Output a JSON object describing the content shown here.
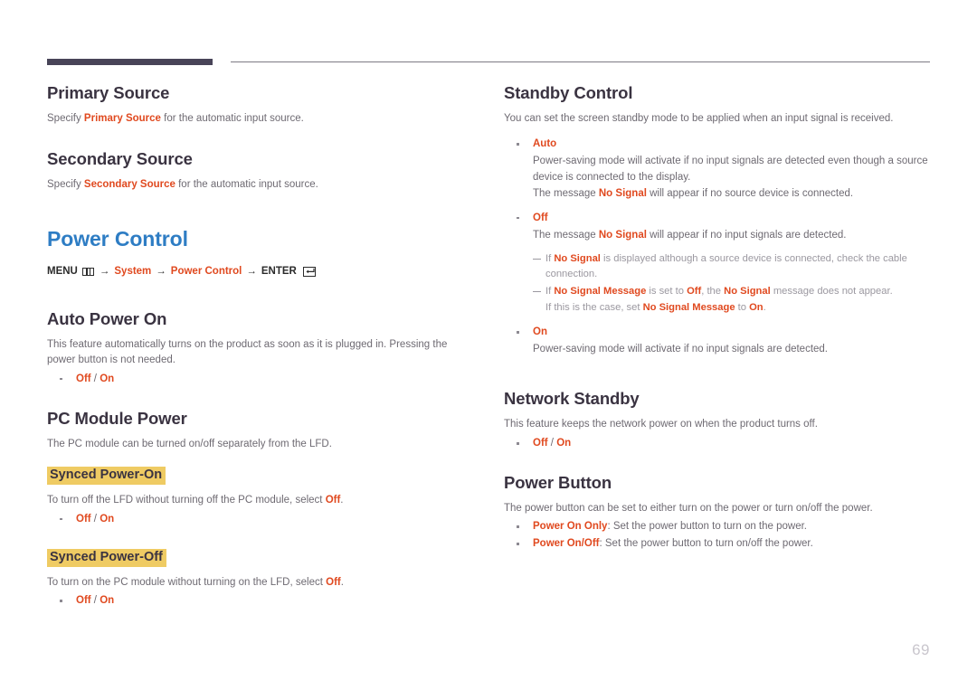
{
  "page": {
    "number": "69"
  },
  "left_column": {
    "primary_source": {
      "heading": "Primary Source",
      "desc_pre": "Specify ",
      "desc_term": "Primary Source",
      "desc_post": " for the automatic input source."
    },
    "secondary_source": {
      "heading": "Secondary Source",
      "desc_pre": "Specify ",
      "desc_term": "Secondary Source",
      "desc_post": " for the automatic input source."
    },
    "power_control": {
      "heading": "Power Control",
      "menu_label": "MENU",
      "menu_icon": "menu-grid-icon",
      "arrow": "→",
      "path_item_1": "System",
      "path_item_2": "Power Control",
      "enter_label": "ENTER",
      "enter_icon": "enter-key-icon"
    },
    "auto_power_on": {
      "heading": "Auto Power On",
      "desc": "This feature automatically turns on the product as soon as it is plugged in. Pressing the power button is not needed.",
      "options": "Off / On",
      "option_off": "Off",
      "option_sep": " / ",
      "option_on": "On"
    },
    "pc_module_power": {
      "heading": "PC Module Power",
      "desc": "The PC module can be turned on/off separately from the LFD.",
      "synced_power_on": {
        "heading": "Synced Power-On",
        "desc_pre": "To turn off the LFD without turning off the PC module, select ",
        "desc_term": "Off",
        "desc_post": ".",
        "option_off": "Off",
        "option_sep": " / ",
        "option_on": "On"
      },
      "synced_power_off": {
        "heading": "Synced Power-Off",
        "desc_pre": "To turn on the PC module without turning on the LFD, select ",
        "desc_term": "Off",
        "desc_post": ".",
        "option_off": "Off",
        "option_sep": " / ",
        "option_on": "On"
      }
    }
  },
  "right_column": {
    "standby_control": {
      "heading": "Standby Control",
      "desc": "You can set the screen standby mode to be applied when an input signal is received.",
      "auto": {
        "label": "Auto",
        "line1": "Power-saving mode will activate if no input signals are detected even though a source device is connected to the display.",
        "line2_pre": "The message ",
        "line2_term": "No Signal",
        "line2_post": " will appear if no source device is connected."
      },
      "off": {
        "label": "Off",
        "line1_pre": "The message ",
        "line1_term": "No Signal",
        "line1_post": " will appear if no input signals are detected.",
        "note1_pre": "If ",
        "note1_term": "No Signal",
        "note1_post": " is displayed although a source device is connected, check the cable connection.",
        "note2_pre": "If ",
        "note2_term1": "No Signal Message",
        "note2_mid1": " is set to ",
        "note2_term2": "Off",
        "note2_mid2": ", the ",
        "note2_term3": "No Signal",
        "note2_post": " message does not appear.",
        "note2_cont_pre": "If this is the case, set ",
        "note2_cont_term": "No Signal Message",
        "note2_cont_mid": " to ",
        "note2_cont_term2": "On",
        "note2_cont_post": "."
      },
      "on": {
        "label": "On",
        "line1": "Power-saving mode will activate if no input signals are detected."
      }
    },
    "network_standby": {
      "heading": "Network Standby",
      "desc": "This feature keeps the network power on when the product turns off.",
      "option_off": "Off",
      "option_sep": " / ",
      "option_on": "On"
    },
    "power_button": {
      "heading": "Power Button",
      "desc": "The power button can be set to either turn on the power or turn on/off the power.",
      "opt1_term": "Power On Only",
      "opt1_text": ": Set the power button to turn on the power.",
      "opt2_term": "Power On/Off",
      "opt2_text": ": Set the power button to turn on/off the power."
    }
  },
  "colors": {
    "accent_blue": "#2e7dc4",
    "accent_orange": "#e0491f",
    "highlight_yellow": "#efcb63",
    "heading_dark": "#3a3341",
    "rule_dark": "#484458",
    "body_gray": "#6e6a72"
  }
}
